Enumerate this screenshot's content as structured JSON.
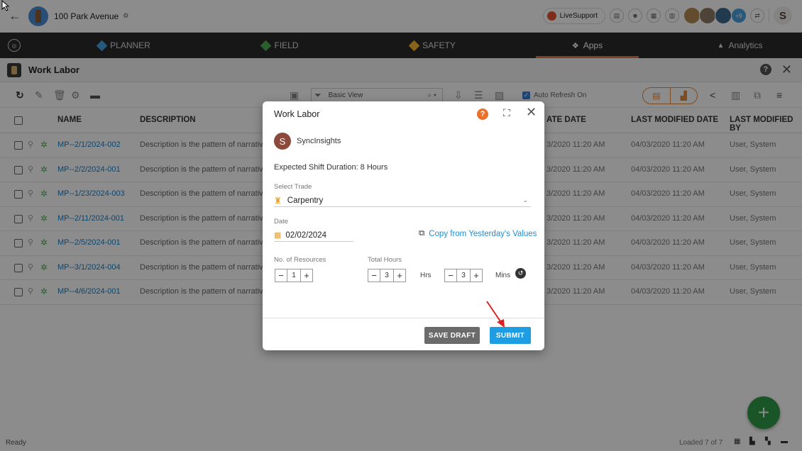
{
  "topbar": {
    "project_name": "100 Park Avenue",
    "live_support": "LiveSupport",
    "more_members": "+9",
    "user_initial": "S"
  },
  "nav": {
    "tabs": [
      {
        "label": "PLANNER",
        "color": "#4aa3df"
      },
      {
        "label": "FIELD",
        "color": "#4caf50"
      },
      {
        "label": "SAFETY",
        "color": "#f2b632"
      },
      {
        "label": "Apps",
        "active": true
      },
      {
        "label": "Analytics"
      }
    ],
    "accent": "#e8743b"
  },
  "module": {
    "title": "Work Labor",
    "close": "✕"
  },
  "toolbar": {
    "view_label": "Basic View",
    "auto_refresh": "Auto Refresh On"
  },
  "table": {
    "headers": {
      "name": "NAME",
      "description": "DESCRIPTION",
      "date": "ATE DATE",
      "last_modified_date": "LAST MODIFIED DATE",
      "last_modified_by": "LAST MODIFIED BY"
    },
    "rows": [
      {
        "name": "MP--2/1/2024-002",
        "description": "Description is the pattern of narrative",
        "date": "3/2020 11:20 AM",
        "modified": "04/03/2020 11:20 AM",
        "by": "User, System"
      },
      {
        "name": "MP--2/2/2024-001",
        "description": "Description is the pattern of narrative",
        "date": "3/2020 11:20 AM",
        "modified": "04/03/2020 11:20 AM",
        "by": "User, System"
      },
      {
        "name": "MP--1/23/2024-003",
        "description": "Description is the pattern of narrative",
        "date": "3/2020 11:20 AM",
        "modified": "04/03/2020 11:20 AM",
        "by": "User, System"
      },
      {
        "name": "MP--2/11/2024-001",
        "description": "Description is the pattern of narrative",
        "date": "3/2020 11:20 AM",
        "modified": "04/03/2020 11:20 AM",
        "by": "User, System"
      },
      {
        "name": "MP--2/5/2024-001",
        "description": "Description is the pattern of narrative",
        "date": "3/2020 11:20 AM",
        "modified": "04/03/2020 11:20 AM",
        "by": "User, System"
      },
      {
        "name": "MP--3/1/2024-004",
        "description": "Description is the pattern of narrative",
        "date": "3/2020 11:20 AM",
        "modified": "04/03/2020 11:20 AM",
        "by": "User, System"
      },
      {
        "name": "MP--4/6/2024-001",
        "description": "Description is the pattern of narrative",
        "date": "3/2020 11:20 AM",
        "modified": "04/03/2020 11:20 AM",
        "by": "User, System"
      }
    ]
  },
  "footer": {
    "status": "Ready",
    "loaded": "Loaded 7 of 7"
  },
  "fab": {
    "label": "+"
  },
  "modal": {
    "title": "Work Labor",
    "org_initial": "S",
    "org_name": "SyncInsights",
    "expected_shift": "Expected Shift Duration: 8 Hours",
    "trade_label": "Select Trade",
    "trade_value": "Carpentry",
    "date_label": "Date",
    "date_value": "02/02/2024",
    "copy_link": "Copy from Yesterday's Values",
    "resources_label": "No. of Resources",
    "resources_value": "1",
    "total_hours_label": "Total Hours",
    "hours_value": "3",
    "hours_unit": "Hrs",
    "mins_value": "3",
    "mins_unit": "Mins",
    "save_draft": "SAVE DRAFT",
    "submit": "SUBMIT"
  }
}
